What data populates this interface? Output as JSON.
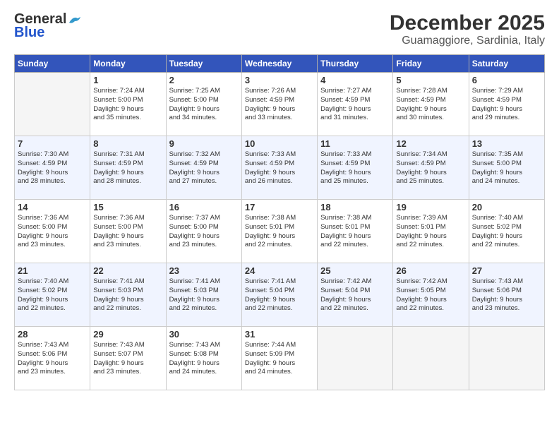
{
  "logo": {
    "general": "General",
    "blue": "Blue"
  },
  "title": "December 2025",
  "subtitle": "Guamaggiore, Sardinia, Italy",
  "headers": [
    "Sunday",
    "Monday",
    "Tuesday",
    "Wednesday",
    "Thursday",
    "Friday",
    "Saturday"
  ],
  "weeks": [
    [
      {
        "day": "",
        "info": ""
      },
      {
        "day": "1",
        "info": "Sunrise: 7:24 AM\nSunset: 5:00 PM\nDaylight: 9 hours\nand 35 minutes."
      },
      {
        "day": "2",
        "info": "Sunrise: 7:25 AM\nSunset: 5:00 PM\nDaylight: 9 hours\nand 34 minutes."
      },
      {
        "day": "3",
        "info": "Sunrise: 7:26 AM\nSunset: 4:59 PM\nDaylight: 9 hours\nand 33 minutes."
      },
      {
        "day": "4",
        "info": "Sunrise: 7:27 AM\nSunset: 4:59 PM\nDaylight: 9 hours\nand 31 minutes."
      },
      {
        "day": "5",
        "info": "Sunrise: 7:28 AM\nSunset: 4:59 PM\nDaylight: 9 hours\nand 30 minutes."
      },
      {
        "day": "6",
        "info": "Sunrise: 7:29 AM\nSunset: 4:59 PM\nDaylight: 9 hours\nand 29 minutes."
      }
    ],
    [
      {
        "day": "7",
        "info": "Sunrise: 7:30 AM\nSunset: 4:59 PM\nDaylight: 9 hours\nand 28 minutes."
      },
      {
        "day": "8",
        "info": "Sunrise: 7:31 AM\nSunset: 4:59 PM\nDaylight: 9 hours\nand 28 minutes."
      },
      {
        "day": "9",
        "info": "Sunrise: 7:32 AM\nSunset: 4:59 PM\nDaylight: 9 hours\nand 27 minutes."
      },
      {
        "day": "10",
        "info": "Sunrise: 7:33 AM\nSunset: 4:59 PM\nDaylight: 9 hours\nand 26 minutes."
      },
      {
        "day": "11",
        "info": "Sunrise: 7:33 AM\nSunset: 4:59 PM\nDaylight: 9 hours\nand 25 minutes."
      },
      {
        "day": "12",
        "info": "Sunrise: 7:34 AM\nSunset: 4:59 PM\nDaylight: 9 hours\nand 25 minutes."
      },
      {
        "day": "13",
        "info": "Sunrise: 7:35 AM\nSunset: 5:00 PM\nDaylight: 9 hours\nand 24 minutes."
      }
    ],
    [
      {
        "day": "14",
        "info": "Sunrise: 7:36 AM\nSunset: 5:00 PM\nDaylight: 9 hours\nand 23 minutes."
      },
      {
        "day": "15",
        "info": "Sunrise: 7:36 AM\nSunset: 5:00 PM\nDaylight: 9 hours\nand 23 minutes."
      },
      {
        "day": "16",
        "info": "Sunrise: 7:37 AM\nSunset: 5:00 PM\nDaylight: 9 hours\nand 23 minutes."
      },
      {
        "day": "17",
        "info": "Sunrise: 7:38 AM\nSunset: 5:01 PM\nDaylight: 9 hours\nand 22 minutes."
      },
      {
        "day": "18",
        "info": "Sunrise: 7:38 AM\nSunset: 5:01 PM\nDaylight: 9 hours\nand 22 minutes."
      },
      {
        "day": "19",
        "info": "Sunrise: 7:39 AM\nSunset: 5:01 PM\nDaylight: 9 hours\nand 22 minutes."
      },
      {
        "day": "20",
        "info": "Sunrise: 7:40 AM\nSunset: 5:02 PM\nDaylight: 9 hours\nand 22 minutes."
      }
    ],
    [
      {
        "day": "21",
        "info": "Sunrise: 7:40 AM\nSunset: 5:02 PM\nDaylight: 9 hours\nand 22 minutes."
      },
      {
        "day": "22",
        "info": "Sunrise: 7:41 AM\nSunset: 5:03 PM\nDaylight: 9 hours\nand 22 minutes."
      },
      {
        "day": "23",
        "info": "Sunrise: 7:41 AM\nSunset: 5:03 PM\nDaylight: 9 hours\nand 22 minutes."
      },
      {
        "day": "24",
        "info": "Sunrise: 7:41 AM\nSunset: 5:04 PM\nDaylight: 9 hours\nand 22 minutes."
      },
      {
        "day": "25",
        "info": "Sunrise: 7:42 AM\nSunset: 5:04 PM\nDaylight: 9 hours\nand 22 minutes."
      },
      {
        "day": "26",
        "info": "Sunrise: 7:42 AM\nSunset: 5:05 PM\nDaylight: 9 hours\nand 22 minutes."
      },
      {
        "day": "27",
        "info": "Sunrise: 7:43 AM\nSunset: 5:06 PM\nDaylight: 9 hours\nand 23 minutes."
      }
    ],
    [
      {
        "day": "28",
        "info": "Sunrise: 7:43 AM\nSunset: 5:06 PM\nDaylight: 9 hours\nand 23 minutes."
      },
      {
        "day": "29",
        "info": "Sunrise: 7:43 AM\nSunset: 5:07 PM\nDaylight: 9 hours\nand 23 minutes."
      },
      {
        "day": "30",
        "info": "Sunrise: 7:43 AM\nSunset: 5:08 PM\nDaylight: 9 hours\nand 24 minutes."
      },
      {
        "day": "31",
        "info": "Sunrise: 7:44 AM\nSunset: 5:09 PM\nDaylight: 9 hours\nand 24 minutes."
      },
      {
        "day": "",
        "info": ""
      },
      {
        "day": "",
        "info": ""
      },
      {
        "day": "",
        "info": ""
      }
    ]
  ]
}
